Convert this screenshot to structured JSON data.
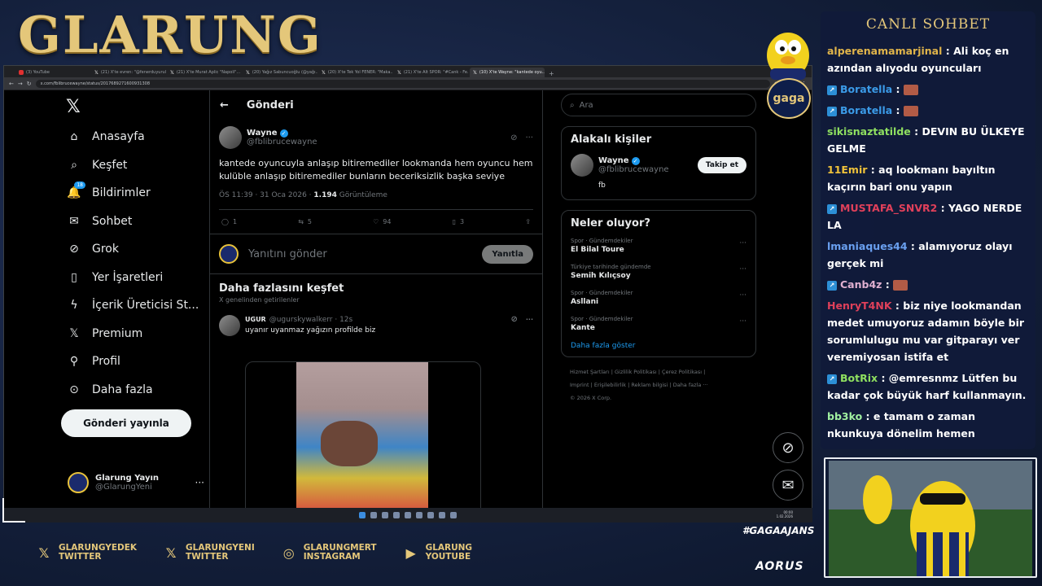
{
  "overlay": {
    "brand": "GLARUNG",
    "chat_title": "CANLI SOHBET",
    "gaga_badge": "gaga",
    "hashtag": "#GAGAAJANS",
    "sponsor": "AORUS",
    "socials": [
      {
        "icon": "x-logo-icon",
        "line1": "GLARUNGYEDEK",
        "line2": "TWITTER"
      },
      {
        "icon": "x-logo-icon",
        "line1": "GLARUNGYENI",
        "line2": "TWITTER"
      },
      {
        "icon": "instagram-icon",
        "line1": "GLARUNGMERT",
        "line2": "INSTAGRAM"
      },
      {
        "icon": "youtube-icon",
        "line1": "GLARUNG",
        "line2": "YOUTUBE"
      }
    ]
  },
  "chat": {
    "messages": [
      {
        "user": "alperenamamarjinal",
        "color": "#e0b44a",
        "text": ": Ali koç en azından alıyodu oyuncuları",
        "emote": false,
        "icon": false
      },
      {
        "user": "Boratella",
        "color": "#3b9be8",
        "text": ":",
        "emote": true,
        "icon": true
      },
      {
        "user": "Boratella",
        "color": "#3b9be8",
        "text": ":",
        "emote": true,
        "icon": true
      },
      {
        "user": "sikisnaztatilde",
        "color": "#8fe060",
        "text": ": DEVIN BU ÜLKEYE GELME",
        "emote": false,
        "icon": false
      },
      {
        "user": "11Emir",
        "color": "#f0c23a",
        "text": ": aq lookmanı bayıltın kaçırın bari onu yapın",
        "emote": false,
        "icon": false
      },
      {
        "user": "MUSTAFA_SNVR2",
        "color": "#e0405a",
        "text": ": YAGO NERDE LA",
        "emote": false,
        "icon": true
      },
      {
        "user": "lmaniaques44",
        "color": "#6aa0f0",
        "text": ": alamıyoruz olayı gerçek mi",
        "emote": false,
        "icon": false
      },
      {
        "user": "Canb4z",
        "color": "#e0b0d0",
        "text": ":",
        "emote": true,
        "icon": true
      },
      {
        "user": "HenryT4NK",
        "color": "#e0405a",
        "text": ": biz niye lookmandan medet umuyoruz adamın böyle bir sorumlulugu mu var gitparayı ver veremiyosan istifa et",
        "emote": false,
        "icon": false
      },
      {
        "user": "BotRix",
        "color": "#8fe060",
        "text": ": @emresnmz Lütfen bu kadar çok büyük harf kullanmayın.",
        "emote": false,
        "icon": true
      },
      {
        "user": "bb3ko",
        "color": "#a0f0a0",
        "text": ": e tamam o zaman nkunkuya dönelim hemen",
        "emote": false,
        "icon": false
      }
    ]
  },
  "browser": {
    "tabs": [
      {
        "label": "(3) YouTube",
        "icon": "youtube"
      },
      {
        "label": "(21) X'te evren: \"@fenerduyurul...",
        "icon": "x"
      },
      {
        "label": "(21) X'te Murat Aplic \"Napoli\"...",
        "icon": "x"
      },
      {
        "label": "(20) Yağız Sabuncuoğlu (@yağı...",
        "icon": "x"
      },
      {
        "label": "(20) X'te Tek Yol FENER: \"Maka...",
        "icon": "x"
      },
      {
        "label": "(21) X'te Alt SPOR: \"#Cank - Fe...",
        "icon": "x"
      },
      {
        "label": "(10) X'te Wayne: \"kantede oyu...",
        "icon": "x",
        "active": true
      }
    ],
    "url": "x.com/fblibrucewayne/status/2017689271600931308"
  },
  "nav": {
    "items": [
      {
        "label": "Anasayfa",
        "icon": "home-icon"
      },
      {
        "label": "Keşfet",
        "icon": "search-icon"
      },
      {
        "label": "Bildirimler",
        "icon": "bell-icon",
        "badge": "18"
      },
      {
        "label": "Sohbet",
        "icon": "mail-icon"
      },
      {
        "label": "Grok",
        "icon": "grok-icon"
      },
      {
        "label": "Yer İşaretleri",
        "icon": "bookmark-icon"
      },
      {
        "label": "İçerik Üreticisi St...",
        "icon": "creator-icon"
      },
      {
        "label": "Premium",
        "icon": "x-logo-icon"
      },
      {
        "label": "Profil",
        "icon": "user-icon"
      },
      {
        "label": "Daha fazla",
        "icon": "more-circle-icon"
      }
    ],
    "post_button": "Gönderi yayınla",
    "profile": {
      "name": "Glarung Yayın",
      "handle": "@GlarungYeni"
    }
  },
  "main": {
    "header": "Gönderi",
    "tweet": {
      "name": "Wayne",
      "handle": "@fblibrucewayne",
      "text": "kantede oyuncuyla anlaşıp bitiremediler lookmanda hem oyuncu hem kulüble anlaşıp bitiremediler bunların beceriksizlik başka seviye",
      "time": "ÖS 11:39 · 31 Oca 2026 · ",
      "views": "1.194",
      "views_label": " Görüntüleme",
      "replies": "1",
      "retweets": "5",
      "likes": "94",
      "bookmarks": "3"
    },
    "reply": {
      "placeholder": "Yanıtını gönder",
      "button": "Yanıtla"
    },
    "explore": {
      "title": "Daha fazlasını keşfet",
      "subtitle": "X genelinden getirilenler",
      "post": {
        "name": "UGUR",
        "handle": "@ugurskywalkerr · 12s",
        "text": "uyanır uyanmaz yağızın profilde biz"
      }
    }
  },
  "right": {
    "search_placeholder": "Ara",
    "related_title": "Alakalı kişiler",
    "related": {
      "name": "Wayne",
      "handle": "@fblibrucewayne",
      "bio": "fb",
      "follow": "Takip et"
    },
    "trends_title": "Neler oluyor?",
    "trends": [
      {
        "category": "Spor · Gündemdekiler",
        "name": "El Bilal Toure"
      },
      {
        "category": "Türkiye tarihinde gündemde",
        "name": "Semih Kılıçsoy"
      },
      {
        "category": "Spor · Gündemdekiler",
        "name": "Asllani"
      },
      {
        "category": "Spor · Gündemdekiler",
        "name": "Kante"
      }
    ],
    "show_more": "Daha fazla göster",
    "footer_line1": "Hizmet Şartları  |  Gizlilik Politikası  |  Çerez Politikası  |",
    "footer_line2": "Imprint  |  Erişilebilirlik  |  Reklam bilgisi  |  Daha fazla ···",
    "footer_line3": "© 2026 X Corp."
  },
  "taskbar": {
    "time": "00:00",
    "date": "1.02.2026"
  }
}
